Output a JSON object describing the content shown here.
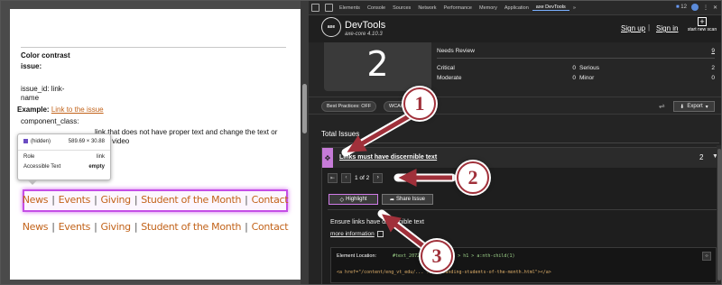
{
  "webpage": {
    "heading": "Color contrast",
    "heading2": "issue:",
    "issue_id_label": "issue_id: link-",
    "issue_id_cont": "name",
    "example_label": "Example:",
    "example_link": "Link to the issue",
    "component_class": "component_class:",
    "partial_text": "link that does not have proper text and change the text or",
    "partial_text2": "he video",
    "nav_items": [
      "News",
      "Events",
      "Giving",
      "Student of the Month",
      "Contact"
    ],
    "nav_separator": "|"
  },
  "tooltip": {
    "tag": "(hidden)",
    "size": "589.69 × 30.88",
    "role_label": "Role",
    "role_value": "link",
    "accessible_label": "Accessible Text",
    "accessible_value": "empty"
  },
  "devtools": {
    "tabs": [
      "Elements",
      "Console",
      "Sources",
      "Network",
      "Performance",
      "Memory",
      "Application",
      "axe DevTools"
    ],
    "more": "»",
    "badge_count": "12"
  },
  "axe": {
    "title": "DevTools",
    "version": "axe-core 4.10.3",
    "logo": "axe",
    "signup": "Sign up",
    "signin": "Sign in",
    "pipe": "|",
    "new_scan": "start new scan",
    "plus": "+"
  },
  "stats": {
    "total": "2",
    "needs_review_label": "Needs Review",
    "needs_review_value": "9",
    "critical_label": "Critical",
    "critical_value": "0",
    "serious_label": "Serious",
    "serious_value": "2",
    "moderate_label": "Moderate",
    "moderate_value": "0",
    "minor_label": "Minor",
    "minor_value": "0"
  },
  "toolbar": {
    "best_practices": "Best Practices: OFF",
    "wcag": "WCAG",
    "export": "Export"
  },
  "issues": {
    "total_label": "Total Issues",
    "title": "Links must have discernible text",
    "count": "2",
    "pager": "1 of 2",
    "highlight": "Highlight",
    "share": "Share Issue",
    "description": "Ensure links have discernible text",
    "more_info": "more information",
    "element_location_label": "Element Location:",
    "element_location_path": "#text_2072487... 905527 > h1 > a:nth-child(1)",
    "snippet": "<a href=\"/content/eng_vt_edu/... ...utstanding-students-of-the-month.html\"></a>"
  },
  "annotations": [
    "1",
    "2",
    "3"
  ],
  "colors": {
    "link_orange": "#c2631a",
    "highlight_purple": "#c54ee6",
    "annotation_red": "#a0303a"
  }
}
